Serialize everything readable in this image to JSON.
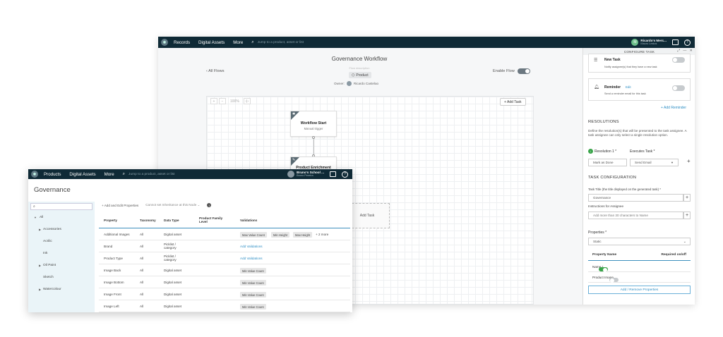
{
  "back_window": {
    "nav": {
      "logo": "✺",
      "items": [
        "Records",
        "Digital Assets",
        "More"
      ],
      "search_placeholder": "Jump to a product, asset or list",
      "user_name": "Ricardo's Merc...",
      "user_sub": "Mauro Lestos",
      "user_initial": "M",
      "help": "?"
    },
    "workflow": {
      "title": "Governance Workflow",
      "description_placeholder": "Flow description",
      "tag": "Product",
      "owner_label": "Owner:",
      "owner_name": "Ricardo Castelao",
      "all_flows": "‹ All Flows",
      "enable_flow": "Enable Flow"
    },
    "canvas": {
      "zoom_plus": "+",
      "zoom_minus": "−",
      "zoom_level": "100%",
      "fit": "‹|›",
      "add_task_button": "+ Add Task",
      "node_start_title": "Workflow Start",
      "node_start_sub": "Manual trigger",
      "node_enrich_title": "Product Enrichment",
      "add_task_placeholder": "Add Task"
    },
    "config": {
      "header": "CONFIGURE TASK",
      "new_task_title": "New Task",
      "new_task_sub": "Notify assignee(s) that they have a new task",
      "reminder_title": "Reminder",
      "reminder_edit": "Edit",
      "reminder_sub": "Send a reminder email for this task",
      "add_reminder": "+ Add Reminder",
      "resolutions_heading": "RESOLUTIONS",
      "resolutions_text": "Define the resolution(s) that will be presented to the task assignee. A task assignee can only select a single resolution option.",
      "resolution_label": "Resolution 1 *",
      "executes_label": "Executes Task *",
      "resolution_value": "Mark as Done",
      "executes_value": "Send Email",
      "task_config_heading": "TASK CONFIGURATION",
      "task_title_label": "Task Title (the title displayed on the generated task) *",
      "task_title_value": "Governance",
      "instructions_label": "Instructions for Assignee",
      "instructions_placeholder": "Add more than 30 characters to Name",
      "properties_label": "Properties *",
      "properties_value": "Static",
      "prop_col_name": "Property Name",
      "prop_col_required": "Required on/off",
      "prop_rows": [
        {
          "name": "Name  *",
          "required": true
        },
        {
          "name": "Product Image",
          "required": false
        }
      ],
      "add_remove_props": "Add / Remove Properties"
    }
  },
  "front_window": {
    "nav": {
      "logo": "✺",
      "items": [
        "Products",
        "Digital Assets",
        "More"
      ],
      "search_placeholder": "Jump to a product, asset or list",
      "user_name": "Bruno's School ...",
      "user_sub": "Bruno Pereira",
      "help": "?"
    },
    "title": "Governance",
    "tree": {
      "search_icon": "search-icon",
      "items": [
        {
          "label": "All",
          "expanded": true,
          "has_children": true
        },
        {
          "label": "Accessories",
          "has_children": true
        },
        {
          "label": "Acrilic",
          "has_children": false
        },
        {
          "label": "Ink",
          "has_children": false
        },
        {
          "label": "Oil Paint",
          "has_children": true
        },
        {
          "label": "Sketch",
          "has_children": false
        },
        {
          "label": "Watercolour",
          "has_children": true
        }
      ]
    },
    "toolbar": {
      "add_edit": "+  Add and Edit Properties",
      "inheritance": "Cannot set Inheritance at this Node  ⌄",
      "info": "i"
    },
    "table": {
      "columns": [
        "Property",
        "Taxonomy",
        "Data Type",
        "Product Family Level",
        "Validations"
      ],
      "rows": [
        {
          "property": "Additional Images",
          "taxonomy": "All",
          "type": "Digital asset",
          "validations": [
            "Max Value Count",
            "Min Height",
            "Max Height"
          ],
          "more": "+ 2 more"
        },
        {
          "property": "Brand",
          "taxonomy": "All",
          "type": "Picklist / category",
          "link": "Add Validations"
        },
        {
          "property": "Product Type",
          "taxonomy": "All",
          "type": "Picklist / category",
          "link": "Add Validations"
        },
        {
          "property": "Image Back",
          "taxonomy": "All",
          "type": "Digital asset",
          "validations": [
            "Min Value Count"
          ]
        },
        {
          "property": "Image Bottom",
          "taxonomy": "All",
          "type": "Digital asset",
          "validations": [
            "Min Value Count"
          ]
        },
        {
          "property": "Image Front",
          "taxonomy": "All",
          "type": "Digital asset",
          "validations": [
            "Min Value Count"
          ]
        },
        {
          "property": "Image Left",
          "taxonomy": "All",
          "type": "Digital asset",
          "validations": [
            "Min Value Count"
          ]
        }
      ]
    }
  }
}
